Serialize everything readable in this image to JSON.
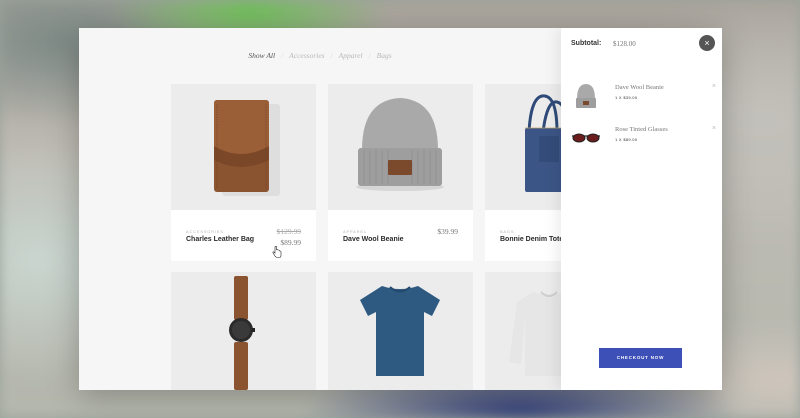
{
  "filters": {
    "items": [
      "Show All",
      "Accessories",
      "Apparel",
      "Bags"
    ],
    "active_index": 0
  },
  "products": [
    {
      "category": "Accessories",
      "name": "Charles Leather Bag",
      "old_price": "$129.99",
      "price": "$89.99"
    },
    {
      "category": "Apparel",
      "name": "Dave Wool Beanie",
      "price": "$39.99"
    },
    {
      "category": "Bags",
      "name": "Bonnie Denim Tote"
    },
    {
      "name": ""
    },
    {
      "name": ""
    },
    {
      "name": ""
    }
  ],
  "cart": {
    "subtotal_label": "Subtotal:",
    "subtotal_value": "$128.00",
    "close_icon": "×",
    "items": [
      {
        "name": "Dave Wool Beanie",
        "qty": "1 X $39.00",
        "remove": "×"
      },
      {
        "name": "Rose Tinted Glasses",
        "qty": "1 X $89.00",
        "remove": "×"
      }
    ],
    "checkout_label": "CHECKOUT NOW"
  },
  "colors": {
    "accent": "#3d50b8",
    "card_image_bg": "#ececec",
    "window_bg": "#f6f6f6"
  }
}
